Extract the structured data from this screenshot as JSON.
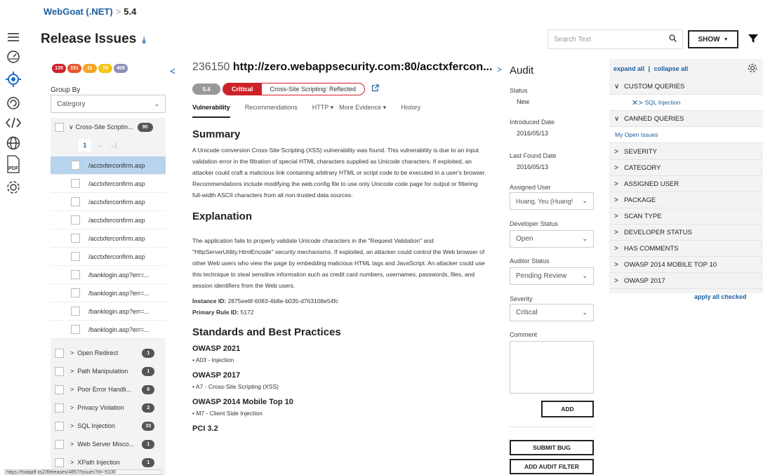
{
  "breadcrumb": {
    "app": "WebGoat (.NET)",
    "separator": ">",
    "version": "5.4"
  },
  "page": {
    "title": "Release Issues",
    "download_icon": "download-icon"
  },
  "search": {
    "placeholder": "Search Text"
  },
  "header": {
    "show_label": "SHOW"
  },
  "rail": {
    "icons": [
      "hamburger-icon",
      "dashboard-icon",
      "target-icon",
      "audit-icon",
      "code-icon",
      "globe-icon",
      "pdf-icon",
      "settings-icon"
    ],
    "pdf_label": "PDF"
  },
  "left": {
    "severity_counts": [
      {
        "value": "135",
        "color": "#cc2229"
      },
      {
        "value": "151",
        "color": "#e8562a"
      },
      {
        "value": "11",
        "color": "#f5a623"
      },
      {
        "value": "74",
        "color": "#f5c518"
      },
      {
        "value": "408",
        "color": "#8e8ebc"
      }
    ],
    "group_by_label": "Group By",
    "group_by_value": "Category",
    "expanded_group": {
      "label": "Cross-Site Scriptin...",
      "count": "90"
    },
    "pager": {
      "page": "1",
      "next": "→",
      "last": "→|"
    },
    "issues": [
      "/acctxferconfirm.asp",
      "/acctxferconfirm.asp",
      "/acctxferconfirm.asp",
      "/acctxferconfirm.asp",
      "/acctxferconfirm.asp",
      "/acctxferconfirm.asp",
      "/banklogin.asp?err=...",
      "/banklogin.asp?err=...",
      "/banklogin.asp?err=...",
      "/banklogin.asp?err=..."
    ],
    "groups": [
      {
        "label": "Open Redirect",
        "count": "1"
      },
      {
        "label": "Path Manipulation",
        "count": "1"
      },
      {
        "label": "Poor Error Handli...",
        "count": "6"
      },
      {
        "label": "Privacy Violation",
        "count": "2"
      },
      {
        "label": "SQL Injection",
        "count": "33"
      },
      {
        "label": "Web Server Misco...",
        "count": "1"
      },
      {
        "label": "XPath Injection",
        "count": "1"
      }
    ]
  },
  "issue": {
    "id": "236150",
    "path": "http://zero.webappsecurity.com:80/acctxfercon...",
    "version": "5.4",
    "severity": "Critical",
    "category": "Cross-Site Scripting: Reflected",
    "tabs": [
      "Vulnerability",
      "Recommendations",
      "HTTP ▾",
      "More Evidence ▾",
      "History"
    ],
    "summary_heading": "Summary",
    "summary_text": "A Unicode conversion Cross-Site Scripting (XSS) vulnerability was found. This vulnerability is due to an input validation error in the filtration of special HTML characters supplied as Unicode characters. If exploited, an attacker could craft a malicious link containing arbitrary HTML or script code to be executed in a user's browser. Recommendations include modifying the web.config file to use only Unicode code page for output or filtering full-width ASCII characters from all non-trusted data sources.",
    "explanation_heading": "Explanation",
    "explanation_text": "The application fails to properly validate Unicode characters in the \"Request Validation\" and \"HttpServerUtility.HtmlEncode\" security mechanisms. If exploited, an attacker could control the Web browser of other Web users who view the page by embedding malicious HTML tags and JavaScript. An attacker could use this technique to steal sensitive information such as credit card numbers, usernames, passwords, files, and session identifiers from the Web users.",
    "instance_label": "Instance ID:",
    "instance_id": "2875ee6f-6083-4b8e-b035-d763108e54fc",
    "rule_label": "Primary Rule ID:",
    "rule_id": "5172",
    "standards_heading": "Standards and Best Practices",
    "standards": [
      {
        "name": "OWASP 2021",
        "item": "A03 - Injection"
      },
      {
        "name": "OWASP 2017",
        "item": "A7 - Cross-Site Scripting (XSS)"
      },
      {
        "name": "OWASP 2014 Mobile Top 10",
        "item": "M7 - Client Side Injection"
      },
      {
        "name": "PCI 3.2",
        "item": ""
      }
    ]
  },
  "audit": {
    "title": "Audit",
    "status_label": "Status",
    "status_value": "New",
    "introduced_label": "Introduced Date",
    "introduced_value": "2016/05/13",
    "last_found_label": "Last Found Date",
    "last_found_value": "2016/05/13",
    "assigned_label": "Assigned User",
    "assigned_value": "Huang, Yeu (Huang!",
    "dev_status_label": "Developer Status",
    "dev_status_value": "Open",
    "auditor_label": "Auditor Status",
    "auditor_value": "Pending Review",
    "severity_label": "Severity",
    "severity_value": "Critical",
    "comment_label": "Comment",
    "add_label": "ADD",
    "submit_bug_label": "SUBMIT BUG",
    "add_filter_label": "ADD AUDIT FILTER"
  },
  "filters": {
    "expand_all": "expand all",
    "divider": "|",
    "collapse_all": "collapse all",
    "custom_queries": "CUSTOM QUERIES",
    "custom_item": "SQL Injection",
    "canned_queries": "CANNED QUERIES",
    "canned_item": "My Open Issues",
    "categories": [
      "SEVERITY",
      "CATEGORY",
      "ASSIGNED USER",
      "PACKAGE",
      "SCAN TYPE",
      "DEVELOPER STATUS",
      "HAS COMMENTS",
      "OWASP 2014 MOBILE TOP 10",
      "OWASP 2017"
    ],
    "apply_all": "apply all checked"
  },
  "status_bar": {
    "url": "https://fodqa9-iis2/Releases/4857/Issues?d=-5100"
  }
}
